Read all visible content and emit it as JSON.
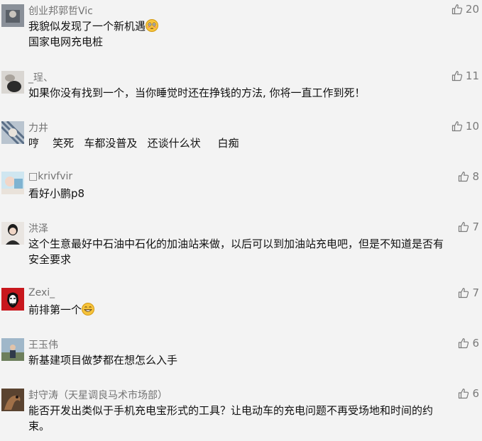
{
  "comments": [
    {
      "username": "创业邦郭哲Vic",
      "lines": [
        "我貌似发现了一个新机遇",
        "国家电网充电桩"
      ],
      "emoji_after_line1": "flushed-face-emoji",
      "likes": "20"
    },
    {
      "username": "_珵、",
      "lines": [
        "如果你没有找到一个，当你睡觉时还在挣钱的方法, 你将一直工作到死！"
      ],
      "likes": "11"
    },
    {
      "username": "力井",
      "lines": [
        "哼    笑死   车都没普及   还谈什么状     白痴"
      ],
      "likes": "10"
    },
    {
      "username": "□krivfvir",
      "lines": [
        "看好小鹏p8"
      ],
      "likes": "8"
    },
    {
      "username": "洪泽",
      "lines": [
        "这个生意最好中石油中石化的加油站来做，以后可以到加油站充电吧，但是不知道是否有安全要求"
      ],
      "likes": "7"
    },
    {
      "username": "Zexi_",
      "lines": [
        "前排第一个"
      ],
      "emoji_after_line1": "grinning-face-emoji",
      "likes": "7"
    },
    {
      "username": "王玉伟",
      "lines": [
        "新基建项目做梦都在想怎么入手"
      ],
      "likes": "6"
    },
    {
      "username": "封守涛（天星调良马术市场部）",
      "lines": [
        "能否开发出类似于手机充电宝形式的工具？让电动车的充电问题不再受场地和时间的约束。"
      ],
      "likes": "6"
    }
  ],
  "icons": {
    "like": "thumbs-up-icon"
  },
  "colors": {
    "background": "#f3f3f3",
    "username": "#737373",
    "text": "#111111",
    "like": "#7a7a7a"
  }
}
